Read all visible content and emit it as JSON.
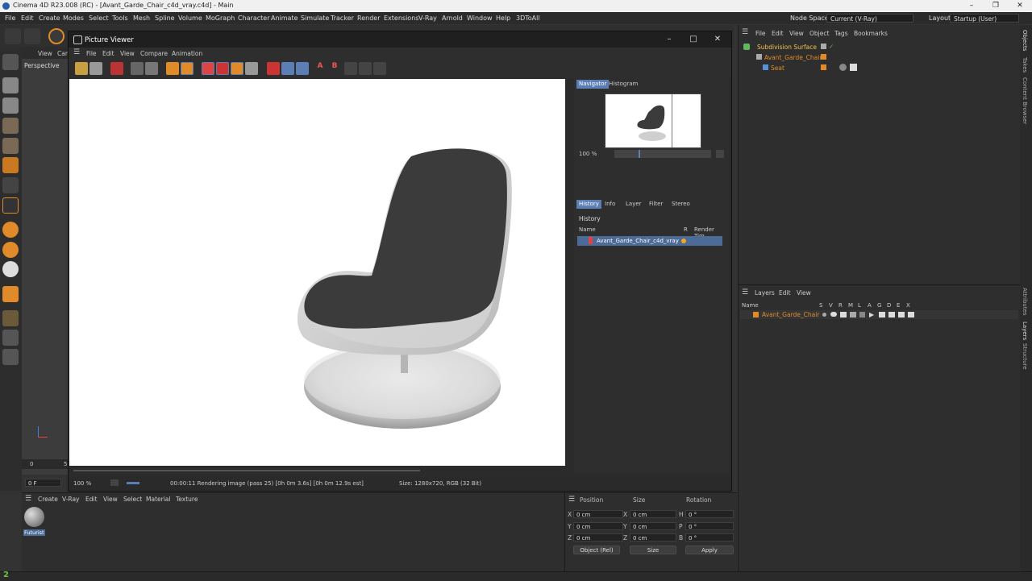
{
  "app": {
    "title": "Cinema 4D R23.008 (RC) - [Avant_Garde_Chair_c4d_vray.c4d] - Main"
  },
  "menubar": {
    "items": [
      "File",
      "Edit",
      "Create",
      "Modes",
      "Select",
      "Tools",
      "Mesh",
      "Spline",
      "Volume",
      "MoGraph",
      "Character",
      "Animate",
      "Simulate",
      "Tracker",
      "Render",
      "Extensions",
      "V-Ray",
      "Arnold",
      "Window",
      "Help",
      "3DToAll"
    ],
    "node_space_label": "Node Space:",
    "node_space_value": "Current (V-Ray)",
    "layout_label": "Layout:",
    "layout_value": "Startup (User)"
  },
  "viewport": {
    "menu": [
      "View",
      "Cam"
    ],
    "label": "Perspective",
    "frame_value": "0 F",
    "timeline_marks": [
      "0",
      "5"
    ]
  },
  "picture_viewer": {
    "title": "Picture Viewer",
    "menu": [
      "File",
      "Edit",
      "View",
      "Compare",
      "Animation"
    ],
    "zoom": "100 %",
    "status": "00:00:11 Rendering image (pass 25) [0h  0m  3.6s] [0h  0m 12.9s est]",
    "size_info": "Size: 1280x720, RGB (32 Bit)",
    "top_tabs": [
      "Navigator",
      "Histogram"
    ],
    "nav_zoom": "100 %",
    "tabs": [
      "History",
      "Info",
      "Layer",
      "Filter",
      "Stereo"
    ],
    "history_title": "History",
    "history_cols": [
      "Name",
      "R",
      "Render Tim"
    ],
    "history_row": "Avant_Garde_Chair_c4d_vray"
  },
  "object_manager": {
    "menu": [
      "File",
      "Edit",
      "View",
      "Object",
      "Tags",
      "Bookmarks"
    ],
    "rows": [
      "Subdivision Surface",
      "Avant_Garde_Chair",
      "Seat"
    ]
  },
  "layers": {
    "menu": [
      "Layers",
      "Edit",
      "View"
    ],
    "name_col": "Name",
    "flags": [
      "S",
      "V",
      "R",
      "M",
      "L",
      "A",
      "G",
      "D",
      "E",
      "X"
    ],
    "row": "Avant_Garde_Chair"
  },
  "side_tabs": [
    "Objects",
    "Takes",
    "Content Browser",
    "Attributes",
    "Layers",
    "Structure"
  ],
  "material_panel": {
    "menu": [
      "Create",
      "V-Ray",
      "Edit",
      "View",
      "Select",
      "Material",
      "Texture"
    ],
    "material_name": "Futurist"
  },
  "coordinates": {
    "headers": [
      "Position",
      "Size",
      "Rotation"
    ],
    "rows": [
      {
        "axis": "X",
        "pos": "0 cm",
        "size_axis": "X",
        "size": "0 cm",
        "rot_axis": "H",
        "rot": "0 °"
      },
      {
        "axis": "Y",
        "pos": "0 cm",
        "size_axis": "Y",
        "size": "0 cm",
        "rot_axis": "P",
        "rot": "0 °"
      },
      {
        "axis": "Z",
        "pos": "0 cm",
        "size_axis": "Z",
        "size": "0 cm",
        "rot_axis": "B",
        "rot": "0 °"
      }
    ],
    "mode": "Object (Rel)",
    "size_mode": "Size",
    "apply": "Apply"
  },
  "colors": {
    "accent": "#5b7fb5",
    "orange": "#e08a2a",
    "chair_fabric": "#3a3a3a",
    "chair_shell": "#d8d8d8"
  }
}
